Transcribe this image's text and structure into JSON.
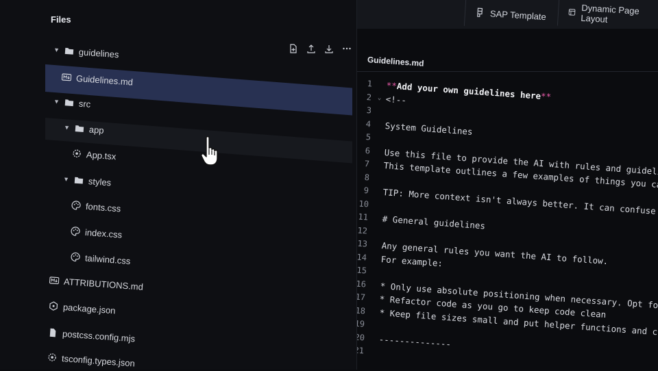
{
  "tabs": [
    {
      "label": "SAP Template",
      "icon": "figma-icon"
    },
    {
      "label": "Dynamic Page Layout",
      "icon": "layout-icon"
    }
  ],
  "files_panel": {
    "title": "Files",
    "tree": [
      {
        "label": "guidelines",
        "type": "folder",
        "expanded": true,
        "icon": "folder-icon"
      },
      {
        "label": "Guidelines.md",
        "type": "file",
        "icon": "markdown-icon",
        "selected": true
      },
      {
        "label": "src",
        "type": "folder",
        "expanded": true,
        "icon": "folder-icon"
      },
      {
        "label": "app",
        "type": "folder",
        "expanded": true,
        "icon": "folder-icon"
      },
      {
        "label": "App.tsx",
        "type": "file",
        "icon": "gear-file-icon"
      },
      {
        "label": "styles",
        "type": "folder",
        "expanded": true,
        "icon": "folder-icon"
      },
      {
        "label": "fonts.css",
        "type": "file",
        "icon": "palette-icon"
      },
      {
        "label": "index.css",
        "type": "file",
        "icon": "palette-icon"
      },
      {
        "label": "tailwind.css",
        "type": "file",
        "icon": "palette-icon"
      },
      {
        "label": "ATTRIBUTIONS.md",
        "type": "file",
        "icon": "markdown-icon"
      },
      {
        "label": "package.json",
        "type": "file",
        "icon": "hexagon-icon"
      },
      {
        "label": "postcss.config.mjs",
        "type": "file",
        "icon": "file-icon"
      },
      {
        "label": "tsconfig.types.json",
        "type": "file",
        "icon": "gear-file-icon"
      }
    ]
  },
  "editor": {
    "filename": "Guidelines.md",
    "lines": [
      {
        "n": "1",
        "parts": [
          {
            "t": "**",
            "c": "pink"
          },
          {
            "t": "Add your own guidelines here",
            "c": "bold"
          },
          {
            "t": "**",
            "c": "pink"
          }
        ]
      },
      {
        "n": "2",
        "fold": "⌄",
        "parts": [
          {
            "t": "<!--",
            "c": ""
          }
        ]
      },
      {
        "n": "3",
        "parts": []
      },
      {
        "n": "4",
        "parts": [
          {
            "t": "System Guidelines",
            "c": ""
          }
        ]
      },
      {
        "n": "5",
        "parts": []
      },
      {
        "n": "6",
        "parts": [
          {
            "t": "Use this file to provide the AI with rules and guidelines you w",
            "c": ""
          }
        ]
      },
      {
        "n": "7",
        "parts": [
          {
            "t": "This template outlines a few examples of things you can add. Yo",
            "c": ""
          }
        ]
      },
      {
        "n": "8",
        "parts": []
      },
      {
        "n": "9",
        "parts": [
          {
            "t": "TIP: More context isn't always better. It can confuse the LLM.",
            "c": ""
          }
        ]
      },
      {
        "n": "10",
        "parts": []
      },
      {
        "n": "11",
        "parts": [
          {
            "t": "# General guidelines",
            "c": ""
          }
        ]
      },
      {
        "n": "12",
        "parts": []
      },
      {
        "n": "13",
        "parts": [
          {
            "t": "Any general rules you want the AI to follow.",
            "c": ""
          }
        ]
      },
      {
        "n": "14",
        "parts": [
          {
            "t": "For example:",
            "c": ""
          }
        ]
      },
      {
        "n": "15",
        "parts": []
      },
      {
        "n": "16",
        "parts": [
          {
            "t": "* Only use absolute positioning when necessary. Opt for respons",
            "c": ""
          }
        ]
      },
      {
        "n": "17",
        "parts": [
          {
            "t": "* Refactor code as you go to keep code clean",
            "c": ""
          }
        ]
      },
      {
        "n": "18",
        "parts": [
          {
            "t": "* Keep file sizes small and put helper functions and components",
            "c": ""
          }
        ]
      },
      {
        "n": "19",
        "parts": []
      },
      {
        "n": "20",
        "parts": [
          {
            "t": "--------------",
            "c": ""
          }
        ]
      },
      {
        "n": "21",
        "parts": []
      }
    ]
  },
  "colors": {
    "selected_row": "#283152",
    "markdown_emphasis": "#e85aa8",
    "background": "#0b0c0f"
  }
}
